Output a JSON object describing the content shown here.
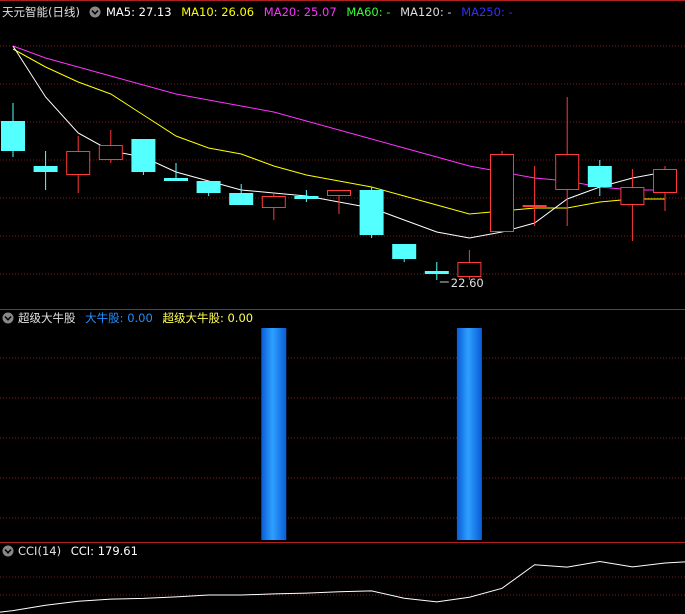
{
  "colors": {
    "bg": "#000000",
    "grid": "#7a1a1a",
    "divider": "#b02020",
    "up": "#ff3a3a",
    "down": "#54ffff",
    "ma5": "#ffffff",
    "ma10": "#ffff00",
    "ma20": "#ff33ff",
    "ma60": "#33ff33",
    "ma120": "#dddddd",
    "ma250": "#3030ff",
    "label": "#dddddd",
    "cci": "#ffffff",
    "bull_blue": "#1e90ff",
    "bull_yellow": "#ffff55"
  },
  "price_panel": {
    "title": "天元智能(日线)",
    "menu_icon": "chevron-down-icon",
    "ma_legend": [
      {
        "key": "ma5",
        "label": "MA5: ",
        "value": "27.13"
      },
      {
        "key": "ma10",
        "label": "MA10: ",
        "value": "26.06"
      },
      {
        "key": "ma20",
        "label": "MA20: ",
        "value": "25.07"
      },
      {
        "key": "ma60",
        "label": "MA60: ",
        "value": "-"
      },
      {
        "key": "ma120",
        "label": "MA120: ",
        "value": "-"
      },
      {
        "key": "ma250",
        "label": "MA250: ",
        "value": "-"
      }
    ],
    "low_annotation": "22.60"
  },
  "bull_panel": {
    "name": "超级大牛股",
    "menu_icon": "chevron-down-icon",
    "legend": [
      {
        "key": "bull_blue",
        "label": "大牛股: ",
        "value": "0.00"
      },
      {
        "key": "bull_yellow",
        "label": "超级大牛股: ",
        "value": "0.00"
      }
    ]
  },
  "cci_panel": {
    "name": "CCI(14)",
    "menu_icon": "chevron-down-icon",
    "legend": [
      {
        "key": "cci",
        "label": "CCI: ",
        "value": "179.61"
      }
    ]
  },
  "chart_data": [
    {
      "type": "candlestick",
      "ylim": [
        22.0,
        31.0
      ],
      "candles": [
        {
          "o": 27.9,
          "h": 28.5,
          "l": 26.7,
          "c": 26.9
        },
        {
          "o": 26.4,
          "h": 26.9,
          "l": 25.6,
          "c": 26.2
        },
        {
          "o": 26.1,
          "h": 27.4,
          "l": 25.5,
          "c": 26.9
        },
        {
          "o": 26.6,
          "h": 27.6,
          "l": 26.5,
          "c": 27.1
        },
        {
          "o": 27.3,
          "h": 27.3,
          "l": 26.1,
          "c": 26.2
        },
        {
          "o": 26.0,
          "h": 26.5,
          "l": 25.9,
          "c": 25.9
        },
        {
          "o": 25.9,
          "h": 25.9,
          "l": 25.4,
          "c": 25.5
        },
        {
          "o": 25.5,
          "h": 25.8,
          "l": 25.1,
          "c": 25.1
        },
        {
          "o": 25.0,
          "h": 25.5,
          "l": 24.6,
          "c": 25.4
        },
        {
          "o": 25.4,
          "h": 25.6,
          "l": 25.2,
          "c": 25.3
        },
        {
          "o": 25.4,
          "h": 25.6,
          "l": 24.8,
          "c": 25.6
        },
        {
          "o": 25.6,
          "h": 25.7,
          "l": 24.0,
          "c": 24.1
        },
        {
          "o": 23.8,
          "h": 23.8,
          "l": 23.2,
          "c": 23.3
        },
        {
          "o": 22.9,
          "h": 23.2,
          "l": 22.6,
          "c": 22.8
        },
        {
          "o": 22.7,
          "h": 23.6,
          "l": 22.6,
          "c": 23.2
        },
        {
          "o": 24.2,
          "h": 26.9,
          "l": 24.2,
          "c": 26.8
        },
        {
          "o": 25.1,
          "h": 26.4,
          "l": 24.4,
          "c": 25.1
        },
        {
          "o": 25.6,
          "h": 28.7,
          "l": 24.4,
          "c": 26.8
        },
        {
          "o": 26.4,
          "h": 26.6,
          "l": 25.4,
          "c": 25.7
        },
        {
          "o": 25.1,
          "h": 26.3,
          "l": 23.9,
          "c": 25.7
        },
        {
          "o": 25.5,
          "h": 26.4,
          "l": 24.9,
          "c": 26.3
        }
      ],
      "ma5": [
        30.4,
        28.7,
        27.5,
        26.9,
        26.7,
        26.2,
        25.9,
        25.6,
        25.5,
        25.4,
        25.2,
        25.0,
        24.6,
        24.2,
        24.0,
        24.2,
        24.5,
        25.3,
        25.7,
        26.0,
        26.2
      ],
      "ma10": [
        30.3,
        29.7,
        29.2,
        28.8,
        28.1,
        27.4,
        27.0,
        26.8,
        26.4,
        26.1,
        25.9,
        25.7,
        25.4,
        25.1,
        24.8,
        24.9,
        25.0,
        25.0,
        25.2,
        25.3,
        25.3
      ],
      "ma20": [
        30.4,
        30.0,
        29.7,
        29.4,
        29.1,
        28.8,
        28.6,
        28.4,
        28.2,
        27.9,
        27.6,
        27.3,
        27.0,
        26.7,
        26.4,
        26.2,
        26.0,
        25.9,
        25.7,
        25.6,
        25.6
      ]
    },
    {
      "type": "bar",
      "ylim": [
        0,
        1
      ],
      "values": [
        0,
        0,
        0,
        0,
        0,
        0,
        0,
        0,
        1,
        0,
        0,
        0,
        0,
        0,
        1,
        0,
        0,
        0,
        0,
        0,
        0
      ]
    },
    {
      "type": "line",
      "values": [
        -212,
        -183,
        -161,
        -150,
        -146,
        -138,
        -128,
        -128,
        -122,
        -118,
        -110,
        -106,
        -145,
        -165,
        -140,
        -92,
        35,
        22,
        52,
        23,
        44
      ]
    }
  ]
}
